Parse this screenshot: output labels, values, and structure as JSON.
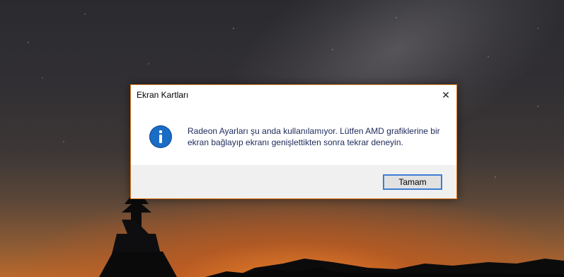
{
  "dialog": {
    "title": "Ekran Kartları",
    "message": "Radeon Ayarları şu anda kullanılamıyor. Lütfen AMD grafiklerine bir ekran bağlayıp ekranı genişlettikten sonra tekrar deneyin.",
    "ok_label": "Tamam",
    "close_glyph": "✕",
    "icon": "info-icon",
    "accent_color": "#e07b20",
    "button_focus_color": "#3c7fd2"
  }
}
